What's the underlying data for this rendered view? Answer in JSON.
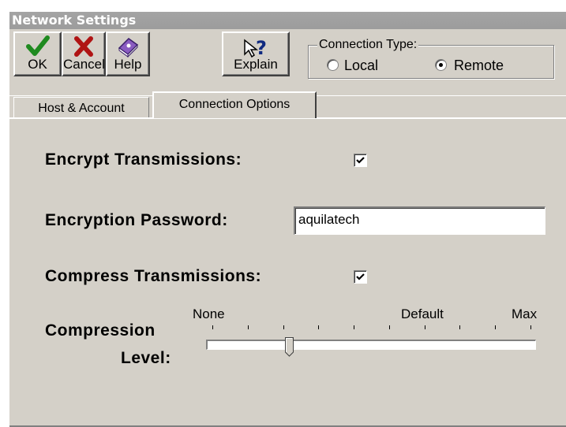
{
  "window": {
    "title": "Network Settings"
  },
  "toolbar": {
    "ok_label": "OK",
    "cancel_label": "Cancel",
    "help_label": "Help",
    "explain_label": "Explain",
    "icons": {
      "ok": "checkmark-icon",
      "cancel": "x-icon",
      "help": "help-book-icon",
      "explain": "explain-question-icon"
    },
    "colors": {
      "ok": "#1f8a1f",
      "cancel": "#b01414",
      "help": "#6b3fa0"
    }
  },
  "connection_type": {
    "legend": "Connection Type:",
    "options": [
      {
        "label": "Local",
        "selected": false
      },
      {
        "label": "Remote",
        "selected": true
      }
    ]
  },
  "tabs": [
    {
      "label": "Host & Account",
      "active": false
    },
    {
      "label": "Connection Options",
      "active": true
    }
  ],
  "options": {
    "encrypt_label": "Encrypt Transmissions:",
    "encrypt_checked": true,
    "password_label": "Encryption Password:",
    "password_value": "aquilatech",
    "compress_label": "Compress Transmissions:",
    "compress_checked": true,
    "compression_level_label_1": "Compression",
    "compression_level_label_2": "Level:"
  },
  "slider": {
    "min_label": "None",
    "default_label": "Default",
    "max_label": "Max",
    "tick_count": 10,
    "value_fraction": 0.24
  }
}
